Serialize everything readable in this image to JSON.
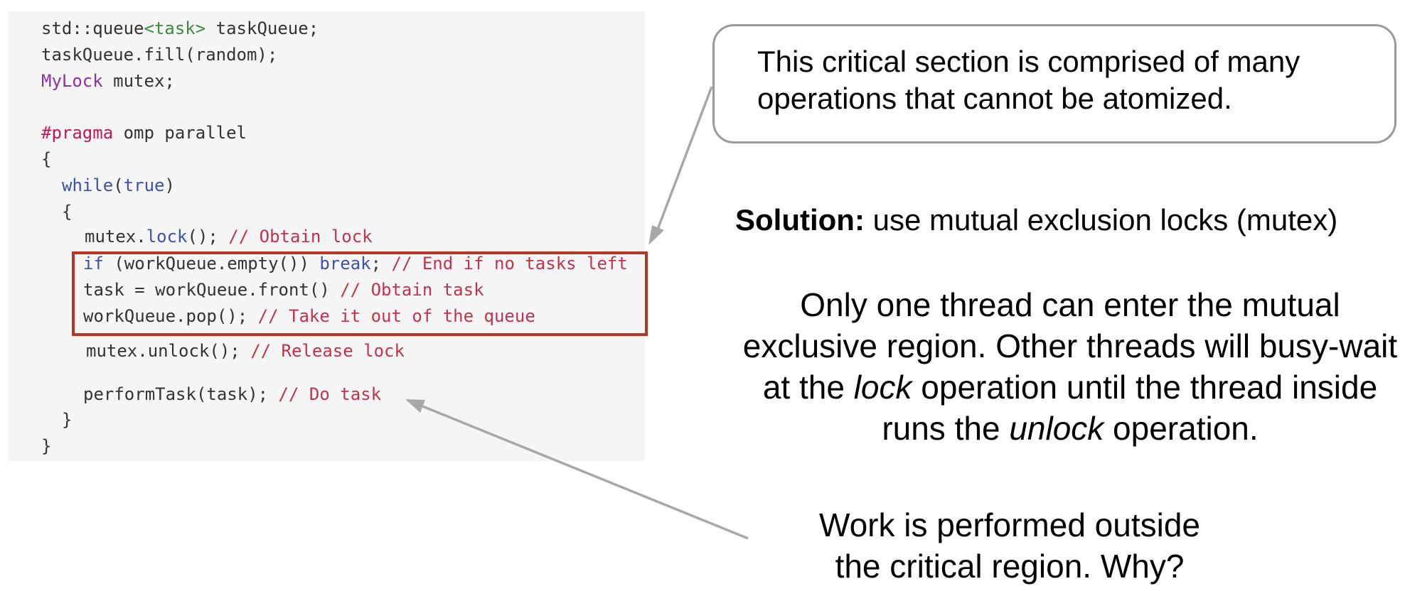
{
  "code": {
    "l1": {
      "a": "std::queue",
      "b": "<task>",
      "c": " taskQueue;"
    },
    "l2": "taskQueue.fill(random);",
    "l3": {
      "a": "MyLock",
      "b": " mutex;"
    },
    "l4": {
      "a": "#pragma",
      "b": " omp parallel"
    },
    "l5": "{",
    "l6": {
      "a": "while",
      "b": "(",
      "c": "true",
      "d": ")"
    },
    "l7": "{",
    "l8": {
      "a": "mutex.",
      "b": "lock",
      "c": "(); ",
      "d": "// Obtain lock"
    },
    "l9": {
      "a": "if",
      "b": " (workQueue.empty()) ",
      "c": "break",
      "d": "; ",
      "e": "// End if no tasks left"
    },
    "l10": {
      "a": "task = workQueue.front() ",
      "b": "// Obtain task"
    },
    "l11": {
      "a": "workQueue.pop(); ",
      "b": "// Take it out of the queue"
    },
    "l12": {
      "a": "mutex.unlock(); ",
      "b": "// Release lock"
    },
    "l13": {
      "a": "performTask(task); ",
      "b": "// Do task"
    },
    "l14": "}",
    "l15": "}"
  },
  "callout": {
    "text": "This critical section is comprised of many operations that cannot be atomized."
  },
  "solution": {
    "label": "Solution:",
    "text": " use mutual exclusion locks (mutex)"
  },
  "explanation": {
    "p1": "Only one thread can enter the mutual exclusive region. Other threads will busy-wait at the ",
    "em1": "lock",
    "p2": " operation until the thread inside runs the ",
    "em2": "unlock",
    "p3": " operation."
  },
  "work_note": {
    "line1": "Work is performed outside",
    "line2": "the critical region. Why?"
  },
  "colors": {
    "highlight_border": "#b83524",
    "keyword": "#3f51a8",
    "comment": "#c0334d",
    "type": "#8e2fa3",
    "template": "#3c8a3c",
    "code_background": "#f5f5f5",
    "arrow": "#a8a8a8"
  }
}
